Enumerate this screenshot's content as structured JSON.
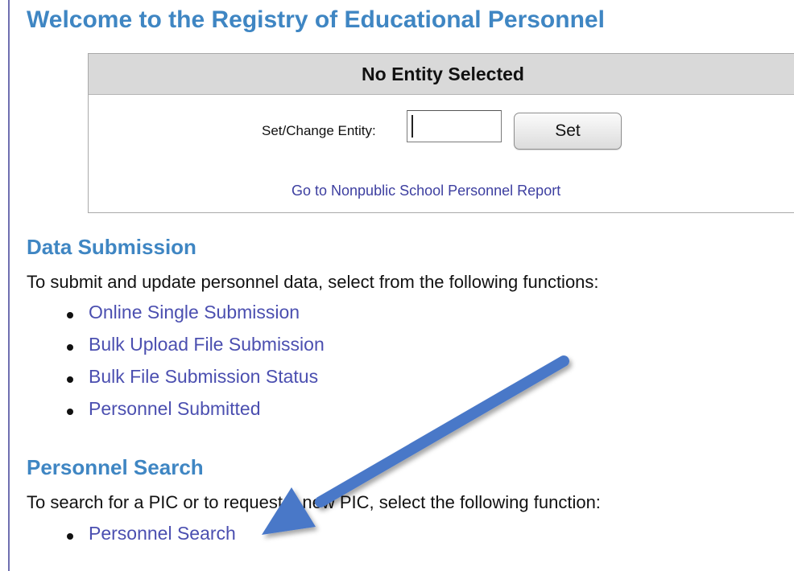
{
  "header": {
    "title": "Welcome to the Registry of Educational Personnel"
  },
  "entity_panel": {
    "header": "No Entity Selected",
    "label": "Set/Change Entity:",
    "input_value": "",
    "set_button_label": "Set",
    "report_link": "Go to Nonpublic School Personnel Report"
  },
  "data_submission": {
    "heading": "Data Submission",
    "description": "To submit and update personnel data, select from the following functions:",
    "links": [
      {
        "label": "Online Single Submission"
      },
      {
        "label": "Bulk Upload File Submission"
      },
      {
        "label": "Bulk File Submission Status"
      },
      {
        "label": "Personnel Submitted"
      }
    ]
  },
  "personnel_search": {
    "heading": "Personnel Search",
    "description": "To search for a PIC or to request a new PIC, select the following function:",
    "links": [
      {
        "label": "Personnel Search"
      }
    ]
  },
  "colors": {
    "heading": "#3f86c3",
    "link": "#4b4fb0",
    "annotation_arrow": "#4a78c8"
  },
  "icons": {
    "annotation": "arrow-pointer-icon"
  }
}
